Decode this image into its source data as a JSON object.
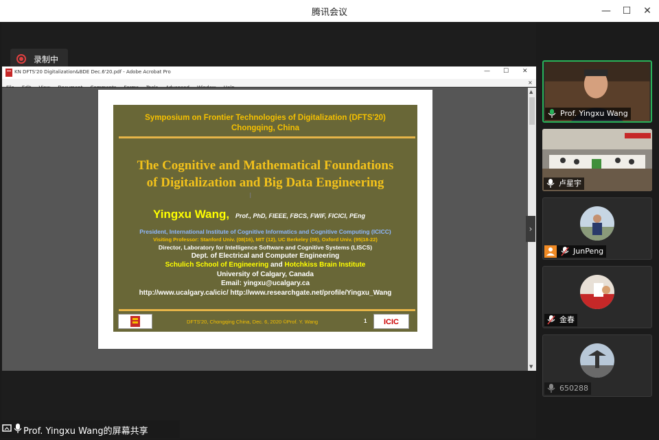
{
  "app": {
    "title": "腾讯会议",
    "recording_label": "录制中",
    "share_banner": "Prof. Yingxu Wang的屏幕共享"
  },
  "acrobat": {
    "window_title": "KN DFTS'20 Digitalization&BDE Dec.6'20.pdf - Adobe Acrobat Pro",
    "menu": [
      "File",
      "Edit",
      "View",
      "Document",
      "Comments",
      "Forms",
      "Tools",
      "Advanced",
      "Window",
      "Help"
    ]
  },
  "slide": {
    "symposium_line1": "Symposium on Frontier Technologies of Digitalization (DFTS'20)",
    "symposium_line2": "Chongqing, China",
    "title_line1": "The Cognitive and Mathematical Foundations",
    "title_line2": "of Digitalization and Big Data Engineering",
    "speaker": "Yingxu Wang,",
    "credentials": "Prof., PhD, FIEEE, FBCS, FWIF, FICICI, PEng",
    "president": "President, International Institute of Cognitive Informatics and Cognitive Computing (ICICC)",
    "visiting": "Visiting Professor: Stanford Univ. (08|16), MIT (12), UC Berkeley (08), Oxford Univ. (95|18-22)",
    "director": "Director, Laboratory for Intelligence Software and Cognitive Systems (LISCS)",
    "dept": "Dept. of Electrical and Computer Engineering",
    "school_a": "Schulich School of Engineering",
    "school_and": "and",
    "school_b": "Hotchkiss Brain Institute",
    "university": "University of Calgary, Canada",
    "email": "Email: yingxu@ucalgary.ca",
    "urls": "http://www.ucalgary.ca/icic/   http://www.researchgate.net/profile/Yingxu_Wang",
    "footer": "DFTS'20, Chongqing China, Dec. 6, 2020  ©Prof. Y. Wang",
    "page_number": "1",
    "logo_text": "ICIC"
  },
  "participants": [
    {
      "name": "Prof. Yingxu Wang",
      "active": true
    },
    {
      "name": "卢星宇",
      "active": false
    },
    {
      "name": "JunPeng",
      "active": false
    },
    {
      "name": "金春",
      "active": false
    },
    {
      "name": "650288",
      "active": false
    }
  ],
  "colors": {
    "slide_bg": "#696737",
    "slide_gold": "#f5c000",
    "speaker_yellow": "#ffff00",
    "active_border": "#28b35a",
    "record_red": "#e04040"
  }
}
